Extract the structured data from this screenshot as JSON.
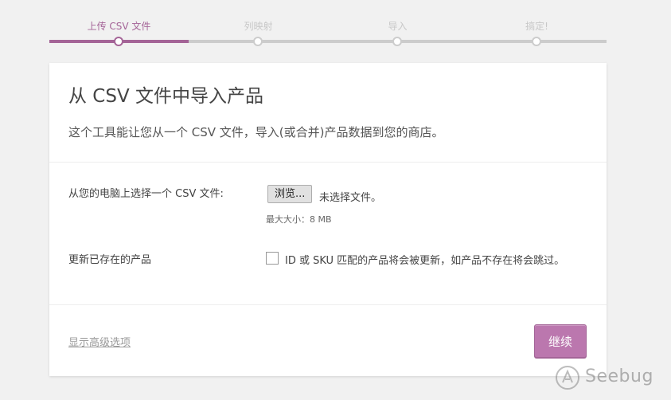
{
  "steps": [
    {
      "label": "上传 CSV 文件",
      "active": true
    },
    {
      "label": "列映射",
      "active": false
    },
    {
      "label": "导入",
      "active": false
    },
    {
      "label": "搞定!",
      "active": false
    }
  ],
  "card": {
    "title": "从 CSV 文件中导入产品",
    "description": "这个工具能让您从一个 CSV 文件，导入(或合并)产品数据到您的商店。"
  },
  "file_row": {
    "label": "从您的电脑上选择一个 CSV 文件:",
    "browse_button": "浏览...",
    "status": "未选择文件。",
    "max_size": "最大大小：8 MB"
  },
  "update_row": {
    "label": "更新已存在的产品",
    "checkbox_label": "ID 或 SKU 匹配的产品将会被更新，如产品不存在将会跳过。",
    "checked": false
  },
  "footer": {
    "advanced_link": "显示高级选项",
    "continue_button": "继续"
  },
  "watermark": {
    "text": "Seebug"
  },
  "colors": {
    "accent": "#a46497",
    "button": "#bb77ae",
    "inactive": "#cccccc",
    "background": "#f1f1f1"
  }
}
